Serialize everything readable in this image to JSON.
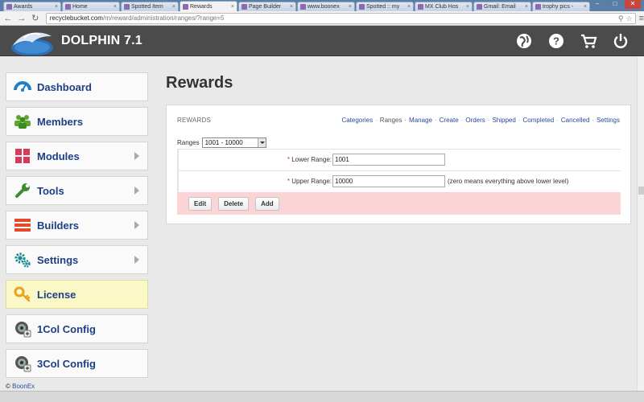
{
  "browser": {
    "tabs": [
      {
        "label": "Awards",
        "active": false
      },
      {
        "label": "Home",
        "active": false
      },
      {
        "label": "Spotted Item",
        "active": false
      },
      {
        "label": "Rewards",
        "active": true
      },
      {
        "label": "Page Builder",
        "active": false
      },
      {
        "label": "www.boonex",
        "active": false
      },
      {
        "label": "Spotted :: my",
        "active": false
      },
      {
        "label": "MX Club Hos",
        "active": false
      },
      {
        "label": "Gmail: Email",
        "active": false
      },
      {
        "label": "trophy pics -",
        "active": false
      }
    ],
    "url_host": "recyclebucket.com",
    "url_path": "/m/reward/administration/ranges/?range=5"
  },
  "header": {
    "brand": "DOLPHIN 7.1"
  },
  "sidebar": {
    "items": [
      {
        "label": "Dashboard",
        "icon": "dashboard-icon",
        "arrow": false
      },
      {
        "label": "Members",
        "icon": "members-icon",
        "arrow": false
      },
      {
        "label": "Modules",
        "icon": "modules-icon",
        "arrow": true
      },
      {
        "label": "Tools",
        "icon": "wrench-icon",
        "arrow": true
      },
      {
        "label": "Builders",
        "icon": "builders-icon",
        "arrow": true
      },
      {
        "label": "Settings",
        "icon": "gears-icon",
        "arrow": true
      },
      {
        "label": "License",
        "icon": "key-icon",
        "arrow": false
      },
      {
        "label": "1Col Config",
        "icon": "config-icon",
        "arrow": false
      },
      {
        "label": "3Col Config",
        "icon": "config-icon",
        "arrow": false
      }
    ]
  },
  "footer": {
    "copyright": "©",
    "link": "BoonEx"
  },
  "main": {
    "title": "Rewards",
    "panel_title": "REWARDS",
    "links": [
      "Categories",
      "Ranges",
      "Manage",
      "Create",
      "Orders",
      "Shipped",
      "Completed",
      "Cancelled",
      "Settings"
    ],
    "current_link": "Ranges",
    "ranges_label": "Ranges",
    "ranges_selected": "1001 - 10000",
    "lower_label": "Lower Range:",
    "lower_value": "1001",
    "upper_label": "Upper Range:",
    "upper_value": "10000",
    "upper_note": "(zero means everything above lower level)",
    "required_mark": "*",
    "buttons": {
      "edit": "Edit",
      "delete": "Delete",
      "add": "Add"
    }
  },
  "colors": {
    "header_bg": "#4b4b4b",
    "menu_text": "#1d3f86",
    "license_bg": "#fbf8c8",
    "action_bar": "#fbd5d5"
  }
}
